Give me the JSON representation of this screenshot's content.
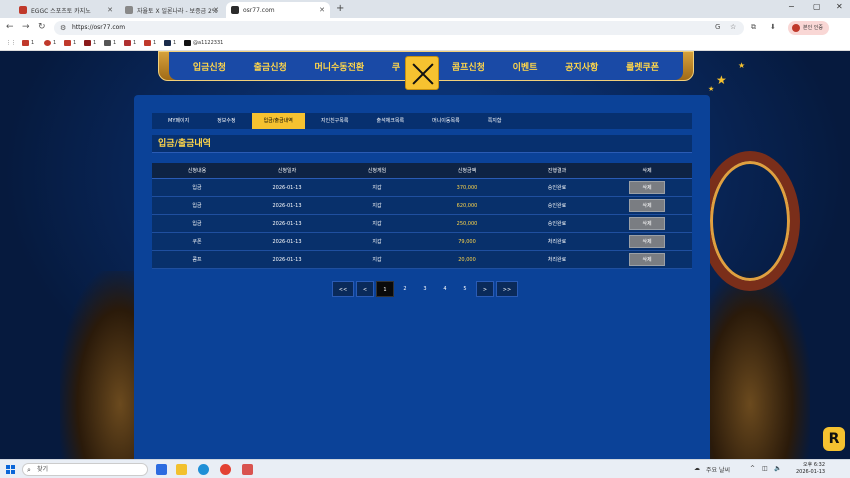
{
  "browser": {
    "tabs": [
      {
        "title": "EGGC 스포츠토 카지노",
        "fav_color": "#c0392b"
      },
      {
        "title": "자율토 X 일론나라 - 보증금 2%",
        "fav_color": "#888888"
      },
      {
        "title": "osr77.com",
        "fav_color": "#2b2b2b"
      }
    ],
    "new_tab": "+",
    "window_controls": {
      "minimize": "−",
      "maximize": "▢",
      "close": "✕"
    },
    "url": "https://osr77.com",
    "profile_label": "본인 인증",
    "bookmarks": [
      {
        "label": "1",
        "color": "#c0392b"
      },
      {
        "label": "1",
        "color": "#c0392b"
      },
      {
        "label": "1",
        "color": "#c0392b"
      },
      {
        "label": "1",
        "color": "#8b1a1a"
      },
      {
        "label": "1",
        "color": "#555555"
      },
      {
        "label": "1",
        "color": "#b03030"
      },
      {
        "label": "1",
        "color": "#1a2b4a"
      },
      {
        "label": "@a1122331",
        "color": "#111111"
      }
    ]
  },
  "site": {
    "nav": [
      "입금신청",
      "출금신청",
      "머니수동전환",
      "쿠",
      "콤프신청",
      "이벤트",
      "공지사항",
      "룰렛쿠폰"
    ],
    "subtabs": [
      {
        "label": "MY페이지",
        "active": false
      },
      {
        "label": "정보수정",
        "active": false
      },
      {
        "label": "입금/출금내역",
        "active": true
      },
      {
        "label": "지인친구목록",
        "active": false
      },
      {
        "label": "출석체크목록",
        "active": false
      },
      {
        "label": "머니이동목록",
        "active": false
      },
      {
        "label": "쪽지함",
        "active": false
      }
    ],
    "page_title": "입금/출금내역",
    "table": {
      "headers": [
        "신청내용",
        "신청일자",
        "신청게임",
        "신청금액",
        "진행결과",
        "삭제"
      ],
      "rows": [
        {
          "type": "입금",
          "date": "2026-01-13",
          "game": "지갑",
          "amount": "370,000",
          "result": "승인완료",
          "delete": "삭제"
        },
        {
          "type": "입금",
          "date": "2026-01-13",
          "game": "지갑",
          "amount": "620,000",
          "result": "승인완료",
          "delete": "삭제"
        },
        {
          "type": "입금",
          "date": "2026-01-13",
          "game": "지갑",
          "amount": "250,000",
          "result": "승인완료",
          "delete": "삭제"
        },
        {
          "type": "쿠폰",
          "date": "2026-01-13",
          "game": "지갑",
          "amount": "79,000",
          "result": "처리완료",
          "delete": "삭제"
        },
        {
          "type": "콤프",
          "date": "2026-01-13",
          "game": "지갑",
          "amount": "20,000",
          "result": "처리완료",
          "delete": "삭제"
        }
      ]
    },
    "pagination": {
      "first": "<<",
      "prev": "<",
      "pages": [
        "1",
        "2",
        "3",
        "4",
        "5"
      ],
      "current": "1",
      "next": ">",
      "last": ">>"
    }
  },
  "taskbar": {
    "search_placeholder": "찾기",
    "weather": "주요 날씨",
    "time": "오후 6:32",
    "date": "2026-01-13"
  }
}
